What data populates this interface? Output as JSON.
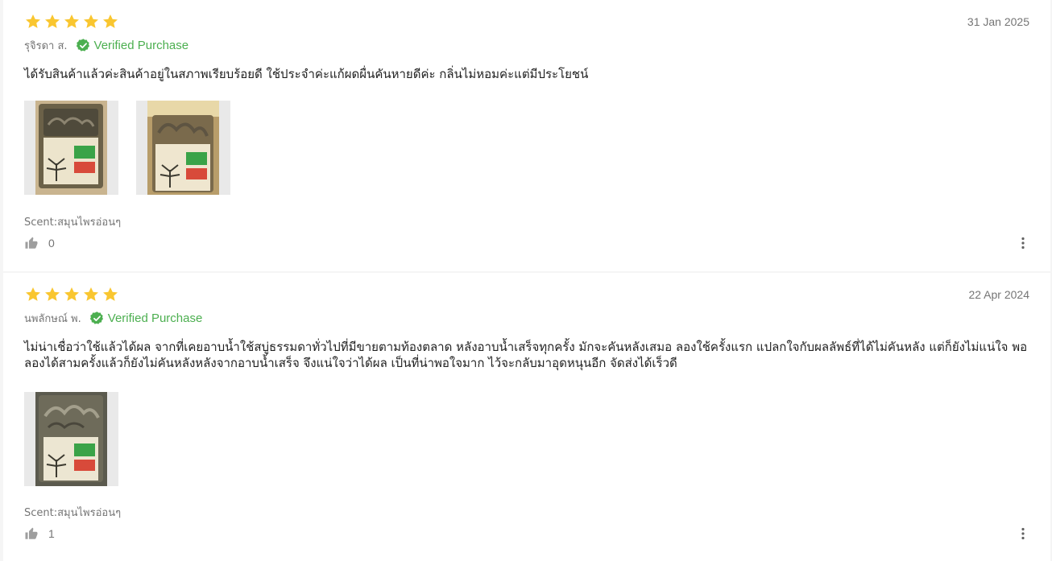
{
  "reviews": [
    {
      "rating": 5,
      "date": "31 Jan 2025",
      "reviewer": "รุจิรดา ส.",
      "verified_label": "Verified Purchase",
      "text": "ได้รับสินค้าแล้วค่ะสินค้าอยู่ในสภาพเรียบร้อยดี ใช้ประจำค่ะแก้ผดผื่นคันหายดีค่ะ กลิ่นไม่หอมค่ะแต่มีประโยชน์",
      "photo_count": 2,
      "scent": "Scent:สมุนไพรอ่อนๆ",
      "likes": "0"
    },
    {
      "rating": 5,
      "date": "22 Apr 2024",
      "reviewer": "นพลักษณ์ พ.",
      "verified_label": "Verified Purchase",
      "text": "ไม่น่าเชื่อว่าใช้แล้วได้ผล จากที่เคยอาบน้ำใช้สบู่ธรรมดาทั่วไปที่มีขายตามท้องตลาด หลังอาบน้ำเสร็จทุกครั้ง มักจะคันหลังเสมอ ลองใช้ครั้งแรก แปลกใจกับผลลัพธ์ที่ได้ไม่คันหลัง แต่ก็ยังไม่แน่ใจ พอลองได้สามครั้งแล้วก็ยังไม่คันหลังหลังจากอาบน้ำเสร็จ จึงแน่ใจว่าได้ผล เป็นที่น่าพอใจมาก ไว้จะกลับมาอุดหนุนอีก จัดส่งได้เร็วดี",
      "photo_count": 1,
      "scent": "Scent:สมุนไพรอ่อนๆ",
      "likes": "1"
    }
  ],
  "colors": {
    "star": "#f9c630",
    "verified": "#4caf50",
    "muted": "#757575"
  },
  "icons": {
    "star": "star-icon",
    "verified": "verified-check-icon",
    "like": "thumbs-up-icon",
    "more": "more-vertical-icon"
  }
}
